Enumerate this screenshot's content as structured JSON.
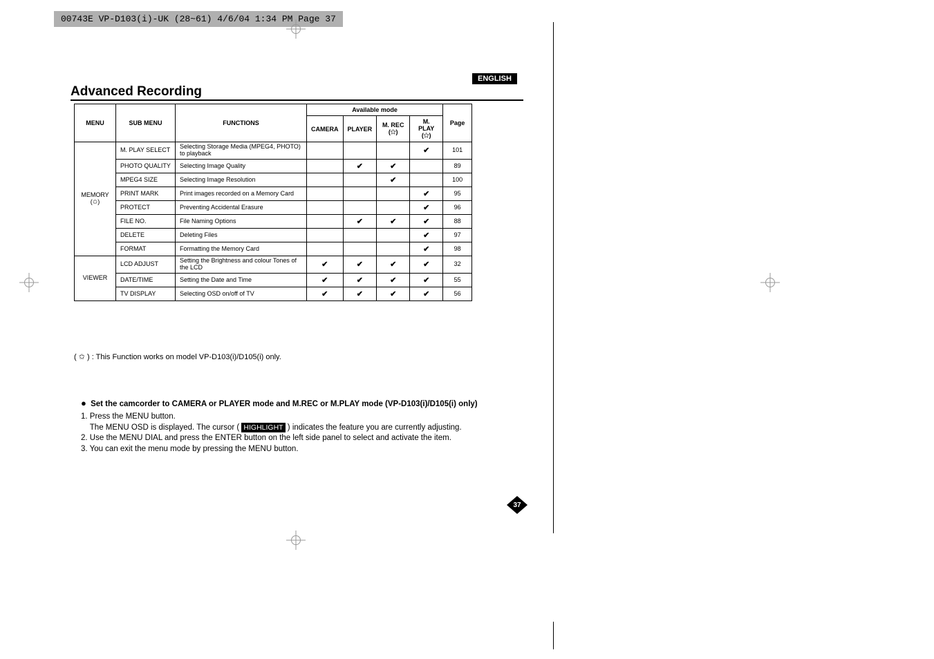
{
  "header_bar": "00743E VP-D103(i)-UK (28~61)  4/6/04 1:34 PM  Page 37",
  "lang_badge": "ENGLISH",
  "title": "Advanced Recording",
  "table": {
    "headers": {
      "menu": "MENU",
      "submenu": "SUB MENU",
      "functions": "FUNCTIONS",
      "available_mode": "Available mode",
      "camera": "CAMERA",
      "player": "PLAYER",
      "mrec": "M. REC (✩)",
      "mplay": "M. PLAY (✩)",
      "page": "Page"
    },
    "groups": [
      {
        "menu": "MEMORY (✩)",
        "rows": [
          {
            "submenu": "M. PLAY SELECT",
            "fn": "Selecting Storage Media (MPEG4, PHOTO) to playback",
            "camera": "",
            "player": "",
            "mrec": "",
            "mplay": "✔",
            "page": "101"
          },
          {
            "submenu": "PHOTO QUALITY",
            "fn": "Selecting Image Quality",
            "camera": "",
            "player": "✔",
            "mrec": "✔",
            "mplay": "",
            "page": "89"
          },
          {
            "submenu": "MPEG4 SIZE",
            "fn": "Selecting Image Resolution",
            "camera": "",
            "player": "",
            "mrec": "✔",
            "mplay": "",
            "page": "100"
          },
          {
            "submenu": "PRINT MARK",
            "fn": "Print images recorded on a Memory Card",
            "camera": "",
            "player": "",
            "mrec": "",
            "mplay": "✔",
            "page": "95"
          },
          {
            "submenu": "PROTECT",
            "fn": "Preventing Accidental Erasure",
            "camera": "",
            "player": "",
            "mrec": "",
            "mplay": "✔",
            "page": "96"
          },
          {
            "submenu": "FILE NO.",
            "fn": "File Naming Options",
            "camera": "",
            "player": "✔",
            "mrec": "✔",
            "mplay": "✔",
            "page": "88"
          },
          {
            "submenu": "DELETE",
            "fn": "Deleting Files",
            "camera": "",
            "player": "",
            "mrec": "",
            "mplay": "✔",
            "page": "97"
          },
          {
            "submenu": "FORMAT",
            "fn": "Formatting the Memory Card",
            "camera": "",
            "player": "",
            "mrec": "",
            "mplay": "✔",
            "page": "98"
          }
        ]
      },
      {
        "menu": "VIEWER",
        "rows": [
          {
            "submenu": "LCD ADJUST",
            "fn": "Setting the Brightness and colour Tones of the LCD",
            "camera": "✔",
            "player": "✔",
            "mrec": "✔",
            "mplay": "✔",
            "page": "32"
          },
          {
            "submenu": "DATE/TIME",
            "fn": "Setting the Date and Time",
            "camera": "✔",
            "player": "✔",
            "mrec": "✔",
            "mplay": "✔",
            "page": "55"
          },
          {
            "submenu": "TV DISPLAY",
            "fn": "Selecting OSD on/off of TV",
            "camera": "✔",
            "player": "✔",
            "mrec": "✔",
            "mplay": "✔",
            "page": "56"
          }
        ]
      }
    ]
  },
  "footnote": "( ✩ ) : This Function works on model VP-D103(i)/D105(i) only.",
  "instructions": {
    "header_prefix": "●",
    "header": "Set the camcorder to CAMERA or PLAYER mode and M.REC or M.PLAY mode (VP-D103(i)/D105(i) only)",
    "line1_label": "1. ",
    "line1a": "Press the MENU button.",
    "line1b_prefix": "The MENU OSD is displayed. The cursor ( ",
    "highlight": "HIGHLIGHT",
    "line1b_suffix": " ) indicates the feature you are currently adjusting.",
    "line2_label": "2. ",
    "line2": "Use the MENU DIAL and press the ENTER button on the left side panel to select and activate the item.",
    "line3_label": "3. ",
    "line3": "You can exit the menu mode by pressing the MENU button."
  },
  "page_number": "37"
}
